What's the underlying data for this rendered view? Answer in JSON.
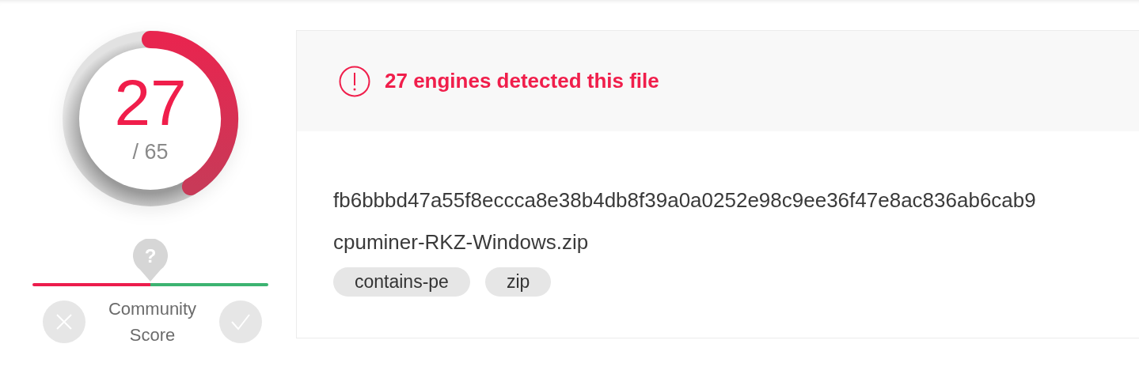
{
  "score": {
    "detections": "27",
    "total": "/ 65"
  },
  "community": {
    "badge": "?",
    "level": 0.5,
    "label": "Community Score"
  },
  "alert": {
    "message": "27 engines detected this file"
  },
  "file": {
    "hash": "fb6bbbd47a55f8eccca8e38b4db8f39a0a0252e98c9ee36f47e8ac836ab6cab9",
    "name": "cpuminer-RKZ-Windows.zip",
    "tags": [
      "contains-pe",
      "zip"
    ]
  }
}
